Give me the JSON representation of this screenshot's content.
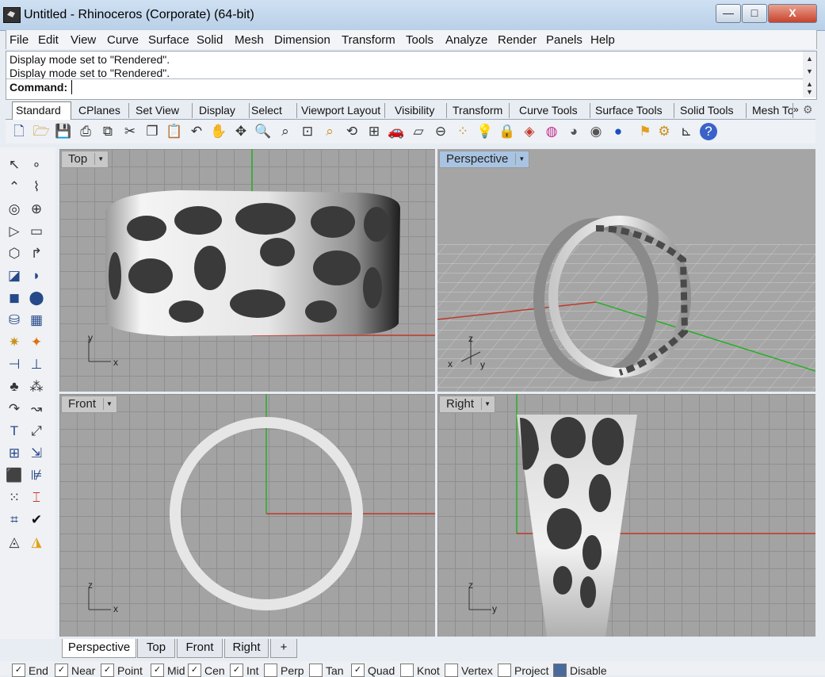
{
  "window": {
    "title": "Untitled - Rhinoceros (Corporate) (64-bit)"
  },
  "window_buttons": {
    "minimize": "—",
    "maximize": "□",
    "close": "X"
  },
  "menu": [
    "File",
    "Edit",
    "View",
    "Curve",
    "Surface",
    "Solid",
    "Mesh",
    "Dimension",
    "Transform",
    "Tools",
    "Analyze",
    "Render",
    "Panels",
    "Help"
  ],
  "command": {
    "history": [
      "Display mode set to \"Rendered\".",
      "Display mode set to \"Rendered\"."
    ],
    "label": "Command:",
    "value": ""
  },
  "toolbar_tabs": [
    "Standard",
    "CPlanes",
    "Set View",
    "Display",
    "Select",
    "Viewport Layout",
    "Visibility",
    "Transform",
    "Curve Tools",
    "Surface Tools",
    "Solid Tools",
    "Mesh To"
  ],
  "toolbar_tabs_active": "Standard",
  "toolbar_icons": [
    "new-icon",
    "open-icon",
    "save-icon",
    "print-icon",
    "import-icon",
    "cut-icon",
    "copy-icon",
    "paste-icon",
    "undo-icon",
    "pan-icon",
    "rotate-view-icon",
    "zoom-icon",
    "zoom-window-icon",
    "zoom-extents-icon",
    "zoom-selected-icon",
    "undo-view-icon",
    "four-viewports-icon",
    "car-icon",
    "properties-icon",
    "circle-icon",
    "points-icon",
    "light-icon",
    "lock-icon",
    "layer-icon",
    "color-wheel-icon",
    "shaded-sphere-icon",
    "rendered-sphere-icon",
    "blue-sphere-icon",
    "flag-icon",
    "gear-icon",
    "dimension-icon",
    "help-icon"
  ],
  "viewports": {
    "top": {
      "label": "Top"
    },
    "perspective": {
      "label": "Perspective"
    },
    "front": {
      "label": "Front"
    },
    "right": {
      "label": "Right"
    }
  },
  "axis_labels": {
    "x": "x",
    "y": "y",
    "z": "z"
  },
  "viewport_tabs": [
    "Perspective",
    "Top",
    "Front",
    "Right"
  ],
  "viewport_tab_add": "+",
  "osnaps": [
    {
      "label": "End",
      "checked": true
    },
    {
      "label": "Near",
      "checked": true
    },
    {
      "label": "Point",
      "checked": true
    },
    {
      "label": "Mid",
      "checked": true
    },
    {
      "label": "Cen",
      "checked": true
    },
    {
      "label": "Int",
      "checked": true
    },
    {
      "label": "Perp",
      "checked": false
    },
    {
      "label": "Tan",
      "checked": false
    },
    {
      "label": "Quad",
      "checked": true
    },
    {
      "label": "Knot",
      "checked": false
    },
    {
      "label": "Vertex",
      "checked": false
    },
    {
      "label": "Project",
      "checked": false
    },
    {
      "label": "Disable",
      "checked": false
    }
  ],
  "colors": {
    "x_axis": "#c0392b",
    "y_axis": "#27ae28",
    "viewport_bg": "#a3a3a3",
    "active_label": "#a9c4e2"
  }
}
